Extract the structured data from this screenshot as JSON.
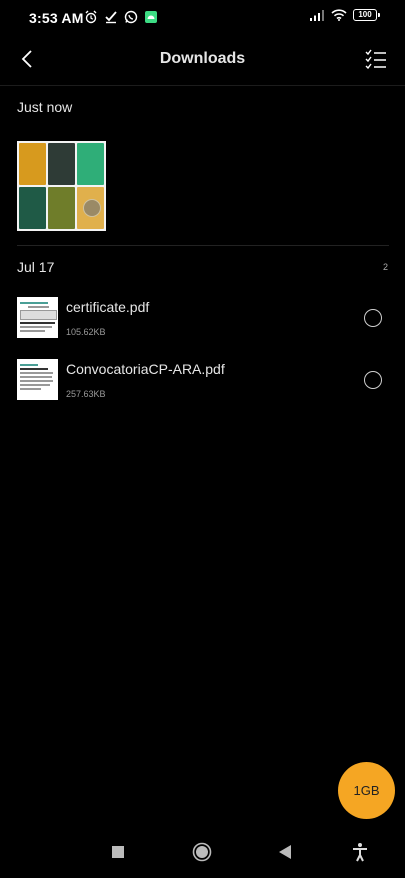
{
  "status_bar": {
    "time": "3:53 AM",
    "battery": "100",
    "left_icons": [
      "alarm-icon",
      "check-icon",
      "whatsapp-icon",
      "android-icon"
    ],
    "right_icons": [
      "signal-icon",
      "wifi-icon",
      "battery-icon"
    ]
  },
  "toolbar": {
    "title": "Downloads",
    "back_icon": "back-arrow-icon",
    "select_icon": "checklist-icon"
  },
  "sections": {
    "just_now": {
      "title": "Just now",
      "thumbnail_colors": [
        "#d79a1e",
        "#2e3b36",
        "#2fae78",
        "#1f5a46",
        "#6f7d2a",
        "#e0b04c"
      ]
    },
    "jul17": {
      "title": "Jul 17",
      "count": "2",
      "files": [
        {
          "name": "certificate.pdf",
          "size": "105.62KB"
        },
        {
          "name": "ConvocatoriaCP-ARA.pdf",
          "size": "257.63KB"
        }
      ]
    }
  },
  "fab": {
    "label": "1GB",
    "color": "#f5a623"
  },
  "navbar": {
    "icons": [
      "recents-icon",
      "home-icon",
      "back-icon",
      "accessibility-icon"
    ]
  }
}
